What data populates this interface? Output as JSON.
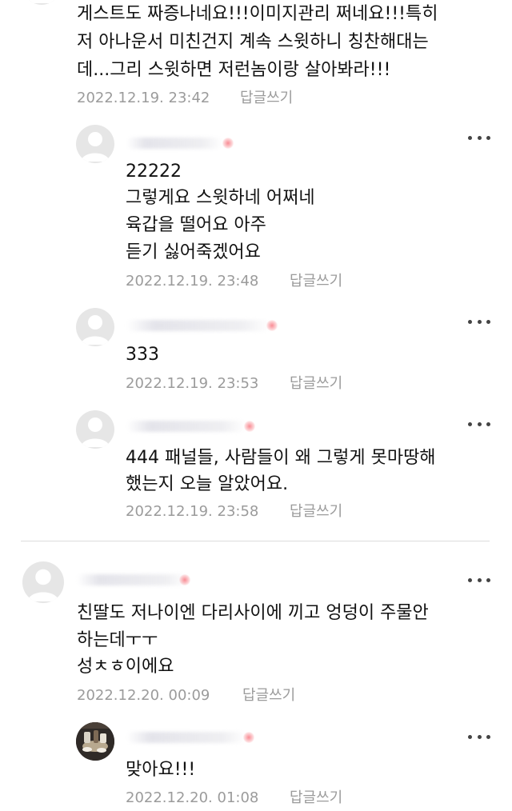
{
  "comments": [
    {
      "id": "c1",
      "lines": [
        "게스트도 짜증나네요!!!이미지관리 쩌네요!!!특히",
        "저 아나운서 미친건지 계속 스윗하니 칭찬해대는",
        "데...그리 스윗하면 저런놈이랑 살아봐라!!!"
      ],
      "date": "2022.12.19. 23:42",
      "reply_label": "답글쓰기"
    },
    {
      "id": "r1",
      "lines": [
        "22222",
        "그렇게요 스윗하네 어쩌네",
        "육갑을 떨어요 아주",
        "듣기 싫어죽겠어요"
      ],
      "date": "2022.12.19. 23:48",
      "reply_label": "답글쓰기"
    },
    {
      "id": "r2",
      "lines": [
        "333"
      ],
      "date": "2022.12.19. 23:53",
      "reply_label": "답글쓰기"
    },
    {
      "id": "r3",
      "lines": [
        "444 패널들, 사람들이 왜 그렇게 못마땅해",
        "했는지 오늘 알았어요."
      ],
      "date": "2022.12.19. 23:58",
      "reply_label": "답글쓰기"
    },
    {
      "id": "c2",
      "lines": [
        "친딸도 저나이엔 다리사이에 끼고 엉덩이 주물안",
        "하는데ㅜㅜ",
        "성ㅊㅎ이에요"
      ],
      "date": "2022.12.20. 00:09",
      "reply_label": "답글쓰기"
    },
    {
      "id": "r4",
      "lines": [
        "맞아요!!!"
      ],
      "date": "2022.12.20. 01:08",
      "reply_label": "답글쓰기"
    }
  ],
  "icons": {
    "more": "more-options-icon",
    "default_avatar": "default-avatar-icon",
    "photo_avatar": "profile-photo-avatar"
  },
  "colors": {
    "text": "#111111",
    "meta": "#9b9b9b",
    "divider": "#dcdcdc",
    "avatar_bg": "#e6e6e6"
  }
}
